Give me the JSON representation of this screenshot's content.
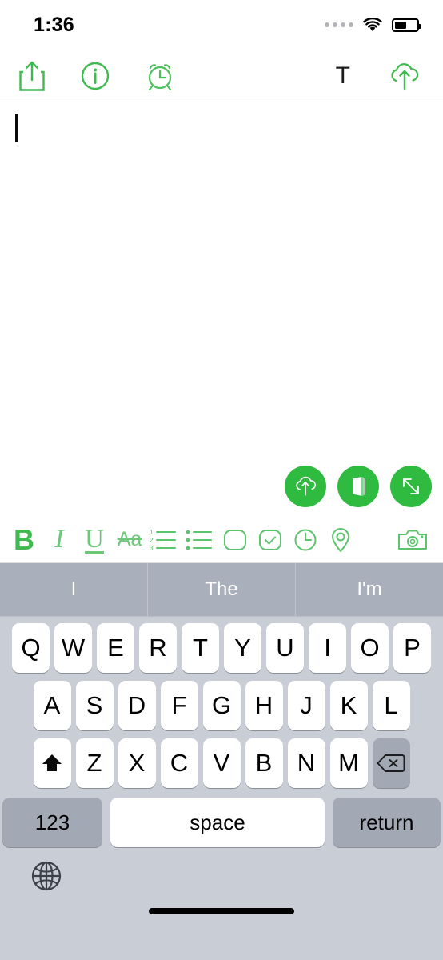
{
  "status_bar": {
    "time": "1:36",
    "signal_icon": "signal-dots-icon",
    "wifi_icon": "wifi-icon",
    "battery_icon": "battery-icon",
    "battery_level_percent": 55
  },
  "app_toolbar": {
    "left_items": [
      {
        "name": "share-icon",
        "label": "Share"
      },
      {
        "name": "info-icon",
        "label": "Info"
      },
      {
        "name": "alarm-clock-icon",
        "label": "Reminder"
      }
    ],
    "right_items": [
      {
        "name": "text-format-icon",
        "label": "T"
      },
      {
        "name": "cloud-upload-icon",
        "label": "Sync"
      }
    ]
  },
  "note": {
    "content": "",
    "caret_visible": true
  },
  "fabs": [
    {
      "name": "cloud-upload-fab",
      "label": "Upload"
    },
    {
      "name": "notebook-fab",
      "label": "Notebook"
    },
    {
      "name": "expand-fab",
      "label": "Expand"
    }
  ],
  "format_toolbar": {
    "items": [
      {
        "name": "bold-button",
        "label": "B"
      },
      {
        "name": "italic-button",
        "label": "I"
      },
      {
        "name": "underline-button",
        "label": "U"
      },
      {
        "name": "strikethrough-button",
        "label": "Aa"
      },
      {
        "name": "numbered-list-button",
        "label": "Numbered list"
      },
      {
        "name": "bulleted-list-button",
        "label": "Bulleted list"
      },
      {
        "name": "checkbox-empty-button",
        "label": "Checkbox"
      },
      {
        "name": "checkbox-checked-button",
        "label": "Checked"
      },
      {
        "name": "clock-button",
        "label": "Time"
      },
      {
        "name": "location-pin-button",
        "label": "Location"
      },
      {
        "name": "camera-button",
        "label": "Camera"
      }
    ]
  },
  "keyboard": {
    "suggestions": [
      "I",
      "The",
      "I'm"
    ],
    "row1": [
      "Q",
      "W",
      "E",
      "R",
      "T",
      "Y",
      "U",
      "I",
      "O",
      "P"
    ],
    "row2": [
      "A",
      "S",
      "D",
      "F",
      "G",
      "H",
      "J",
      "K",
      "L"
    ],
    "row3": [
      "Z",
      "X",
      "C",
      "V",
      "B",
      "N",
      "M"
    ],
    "shift_key": {
      "name": "shift-key",
      "label": ""
    },
    "delete_key": {
      "name": "delete-key",
      "label": ""
    },
    "numbers_key": "123",
    "space_key": "space",
    "return_key": "return",
    "globe_key": {
      "name": "globe-key",
      "label": ""
    }
  },
  "colors": {
    "accent_green": "#2fbb3f",
    "icon_green": "#5cc46c",
    "keyboard_bg": "#c9cdd6",
    "suggest_bg": "#aab0bb",
    "key_white": "#ffffff",
    "key_gray": "#a3a9b4"
  }
}
